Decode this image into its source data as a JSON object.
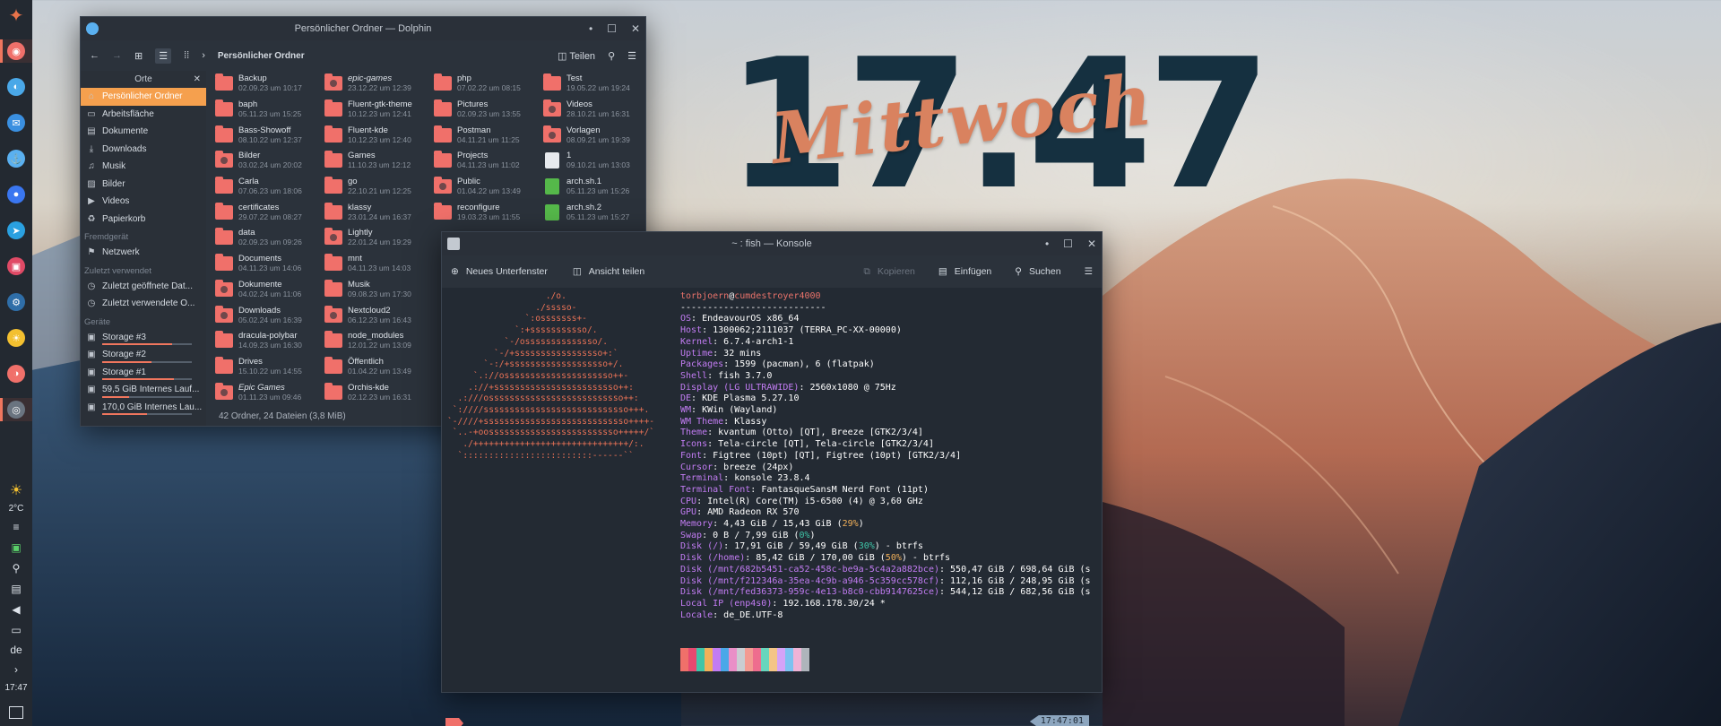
{
  "clock": {
    "time": "17.47",
    "day": "Mittwoch"
  },
  "panel": {
    "launcher_icon": "endeavour-logo-icon",
    "tasks": [
      {
        "name": "vivaldi",
        "color": "#f0706a",
        "glyph": "◉",
        "active": true
      },
      {
        "name": "firefox",
        "color": "#4aa8e8",
        "glyph": "◐",
        "active": false
      },
      {
        "name": "thunderbird",
        "color": "#3a8fe0",
        "glyph": "✉",
        "active": false
      },
      {
        "name": "mastodon",
        "color": "#5ab0f0",
        "glyph": "⚓",
        "active": false
      },
      {
        "name": "signal",
        "color": "#3a76f0",
        "glyph": "●",
        "active": false
      },
      {
        "name": "telegram",
        "color": "#2aa0e0",
        "glyph": "➤",
        "active": false
      },
      {
        "name": "store",
        "color": "#e04a66",
        "glyph": "▣",
        "active": false
      },
      {
        "name": "steam",
        "color": "#2f6ea8",
        "glyph": "⚙",
        "active": false
      },
      {
        "name": "sunny",
        "color": "#f3c030",
        "glyph": "☀",
        "active": false
      },
      {
        "name": "toggle",
        "color": "#f0706a",
        "glyph": "◑",
        "active": false
      },
      {
        "name": "disk",
        "color": "#6a7480",
        "glyph": "◎",
        "active": true
      }
    ],
    "weather_temp": "2°C",
    "keyboard_layout": "de",
    "time": "17:47"
  },
  "dolphin": {
    "title": "Persönlicher Ordner — Dolphin",
    "toolbar": {
      "breadcrumb": "Persönlicher Ordner",
      "split_label": "Teilen"
    },
    "places_header": "Orte",
    "places": [
      {
        "label": "Persönlicher Ordner",
        "icon": "⌂",
        "selected": true
      },
      {
        "label": "Arbeitsfläche",
        "icon": "▭"
      },
      {
        "label": "Dokumente",
        "icon": "▤"
      },
      {
        "label": "Downloads",
        "icon": "⤓"
      },
      {
        "label": "Musik",
        "icon": "♫"
      },
      {
        "label": "Bilder",
        "icon": "▨"
      },
      {
        "label": "Videos",
        "icon": "▶"
      },
      {
        "label": "Papierkorb",
        "icon": "♻"
      }
    ],
    "remote_header": "Fremdgerät",
    "remote": [
      {
        "label": "Netzwerk",
        "icon": "⚑"
      }
    ],
    "recent_header": "Zuletzt verwendet",
    "recent": [
      {
        "label": "Zuletzt geöffnete Dat...",
        "icon": "◷"
      },
      {
        "label": "Zuletzt verwendete O...",
        "icon": "◷"
      }
    ],
    "devices_header": "Geräte",
    "devices": [
      {
        "label": "Storage #3",
        "fill": 0.78
      },
      {
        "label": "Storage #2",
        "fill": 0.55
      },
      {
        "label": "Storage #1",
        "fill": 0.8
      },
      {
        "label": "59,5 GiB Internes Lauf...",
        "fill": 0.3
      },
      {
        "label": "170,0 GiB Internes Lau...",
        "fill": 0.5
      }
    ],
    "files": [
      {
        "name": "Backup",
        "date": "02.09.23 um 10:17",
        "kind": "folder"
      },
      {
        "name": "baph",
        "date": "05.11.23 um 15:25",
        "kind": "folder"
      },
      {
        "name": "Bass-Showoff",
        "date": "08.10.22 um 12:37",
        "kind": "folder"
      },
      {
        "name": "Bilder",
        "date": "03.02.24 um 20:02",
        "kind": "folder-img"
      },
      {
        "name": "Carla",
        "date": "07.06.23 um 18:06",
        "kind": "folder"
      },
      {
        "name": "certificates",
        "date": "29.07.22 um 08:27",
        "kind": "folder"
      },
      {
        "name": "data",
        "date": "02.09.23 um 09:26",
        "kind": "folder"
      },
      {
        "name": "Documents",
        "date": "04.11.23 um 14:06",
        "kind": "folder"
      },
      {
        "name": "Dokumente",
        "date": "04.02.24 um 11:06",
        "kind": "folder-img"
      },
      {
        "name": "Downloads",
        "date": "05.02.24 um 16:39",
        "kind": "folder-img"
      },
      {
        "name": "dracula-polybar",
        "date": "14.09.23 um 16:30",
        "kind": "folder"
      },
      {
        "name": "Drives",
        "date": "15.10.22 um 14:55",
        "kind": "folder"
      },
      {
        "name": "Epic Games",
        "date": "01.11.23 um 09:46",
        "kind": "folder-ic",
        "italic": true
      },
      {
        "name": "",
        "date": "",
        "kind": "empty"
      },
      {
        "name": "epic-games",
        "date": "23.12.22 um 12:39",
        "kind": "folder-ic",
        "italic": true
      },
      {
        "name": "Fluent-gtk-theme",
        "date": "10.12.23 um 12:41",
        "kind": "folder"
      },
      {
        "name": "Fluent-kde",
        "date": "10.12.23 um 12:40",
        "kind": "folder"
      },
      {
        "name": "Games",
        "date": "11.10.23 um 12:12",
        "kind": "folder"
      },
      {
        "name": "go",
        "date": "22.10.21 um 12:25",
        "kind": "folder"
      },
      {
        "name": "klassy",
        "date": "23.01.24 um 16:37",
        "kind": "folder"
      },
      {
        "name": "Lightly",
        "date": "22.01.24 um 19:29",
        "kind": "folder-img"
      },
      {
        "name": "mnt",
        "date": "04.11.23 um 14:03",
        "kind": "folder"
      },
      {
        "name": "Musik",
        "date": "09.08.23 um 17:30",
        "kind": "folder"
      },
      {
        "name": "Nextcloud2",
        "date": "06.12.23 um 16:43",
        "kind": "folder-ic"
      },
      {
        "name": "node_modules",
        "date": "12.01.22 um 13:09",
        "kind": "folder"
      },
      {
        "name": "Öffentlich",
        "date": "01.04.22 um 13:49",
        "kind": "folder"
      },
      {
        "name": "Orchis-kde",
        "date": "02.12.23 um 16:31",
        "kind": "folder"
      },
      {
        "name": "",
        "date": "",
        "kind": "empty"
      },
      {
        "name": "php",
        "date": "07.02.22 um 08:15",
        "kind": "folder"
      },
      {
        "name": "Pictures",
        "date": "02.09.23 um 13:55",
        "kind": "folder"
      },
      {
        "name": "Postman",
        "date": "04.11.21 um 11:25",
        "kind": "folder"
      },
      {
        "name": "Projects",
        "date": "04.11.23 um 11:02",
        "kind": "folder"
      },
      {
        "name": "Public",
        "date": "01.04.22 um 13:49",
        "kind": "folder-ic"
      },
      {
        "name": "reconfigure",
        "date": "19.03.23 um 11:55",
        "kind": "folder"
      },
      {
        "name": "",
        "date": "",
        "kind": "empty"
      },
      {
        "name": "",
        "date": "",
        "kind": "empty"
      },
      {
        "name": "",
        "date": "",
        "kind": "empty"
      },
      {
        "name": "",
        "date": "",
        "kind": "empty"
      },
      {
        "name": "",
        "date": "",
        "kind": "empty"
      },
      {
        "name": "",
        "date": "",
        "kind": "empty"
      },
      {
        "name": "",
        "date": "",
        "kind": "empty"
      },
      {
        "name": "",
        "date": "",
        "kind": "empty"
      },
      {
        "name": "Test",
        "date": "19.05.22 um 19:24",
        "kind": "folder"
      },
      {
        "name": "Videos",
        "date": "28.10.21 um 16:31",
        "kind": "folder-ic"
      },
      {
        "name": "Vorlagen",
        "date": "08.09.21 um 19:39",
        "kind": "folder-ic"
      },
      {
        "name": "1",
        "date": "09.10.21 um 13:03",
        "kind": "file"
      },
      {
        "name": "arch.sh.1",
        "date": "05.11.23 um 15:26",
        "kind": "script"
      },
      {
        "name": "arch.sh.2",
        "date": "05.11.23 um 15:27",
        "kind": "script"
      }
    ],
    "status": "42 Ordner, 24 Dateien (3,8 MiB)"
  },
  "konsole": {
    "title": "~ : fish — Konsole",
    "toolbar": {
      "new_tab": "Neues Unterfenster",
      "split": "Ansicht teilen",
      "copy": "Kopieren",
      "paste": "Einfügen",
      "find": "Suchen"
    },
    "logo_lines": [
      "                   ./o.",
      "                 ./sssso-",
      "               `:osssssss+-",
      "             `:+sssssssssso/.",
      "           `-/ossssssssssssso/.",
      "         `-/+sssssssssssssssso+:`",
      "       `-:/+sssssssssssssssssso+/.",
      "     `.://osssssssssssssssssssso++-",
      "    .://+ssssssssssssssssssssssso++:",
      "  .:///ossssssssssssssssssssssssso++:",
      " `:////ssssssssssssssssssssssssssso+++.",
      "`-////+ssssssssssssssssssssssssssso++++-",
      " `..-+oosssssssssssssssssssssssso+++++/`",
      "   ./++++++++++++++++++++++++++++++/:.",
      "  `:::::::::::::::::::::::::------``"
    ],
    "user": "torbjoern",
    "at": "@",
    "host": "cumdestroyer4000",
    "separator": "---------------------------",
    "info": [
      {
        "k": "OS",
        "v": "EndeavourOS x86_64"
      },
      {
        "k": "Host",
        "v": "1300062;2111037 (TERRA_PC-XX-00000)"
      },
      {
        "k": "Kernel",
        "v": "6.7.4-arch1-1"
      },
      {
        "k": "Uptime",
        "v": "32 mins"
      },
      {
        "k": "Packages",
        "v": "1599 (pacman), 6 (flatpak)"
      },
      {
        "k": "Shell",
        "v": "fish 3.7.0"
      },
      {
        "k": "Display (LG ULTRAWIDE)",
        "v": "2560x1080 @ 75Hz"
      },
      {
        "k": "DE",
        "v": "KDE Plasma 5.27.10"
      },
      {
        "k": "WM",
        "v": "KWin (Wayland)"
      },
      {
        "k": "WM Theme",
        "v": "Klassy"
      },
      {
        "k": "Theme",
        "v": "kvantum (Otto) [QT], Breeze [GTK2/3/4]"
      },
      {
        "k": "Icons",
        "v": "Tela-circle [QT], Tela-circle [GTK2/3/4]"
      },
      {
        "k": "Font",
        "v": "Figtree (10pt) [QT], Figtree (10pt) [GTK2/3/4]"
      },
      {
        "k": "Cursor",
        "v": "breeze (24px)"
      },
      {
        "k": "Terminal",
        "v": "konsole 23.8.4"
      },
      {
        "k": "Terminal Font",
        "v": "FantasqueSansM Nerd Font (11pt)"
      },
      {
        "k": "CPU",
        "v": "Intel(R) Core(TM) i5-6500 (4) @ 3,60 GHz"
      },
      {
        "k": "GPU",
        "v": "AMD Radeon RX 570"
      },
      {
        "k": "Memory",
        "v": "4,43 GiB / 15,43 GiB (",
        "pct": "29%",
        "end": ")",
        "pc": "y"
      },
      {
        "k": "Swap",
        "v": "0 B / 7,99 GiB (",
        "pct": "0%",
        "end": ")",
        "pc": "g"
      },
      {
        "k": "Disk (/)",
        "v": "17,91 GiB / 59,49 GiB (",
        "pct": "30%",
        "end": ") - btrfs",
        "pc": "g"
      },
      {
        "k": "Disk (/home)",
        "v": "85,42 GiB / 170,00 GiB (",
        "pct": "50%",
        "end": ") - btrfs",
        "pc": "y"
      },
      {
        "k": "Disk (/mnt/682b5451-ca52-458c-be9a-5c4a2a882bce)",
        "v": "550,47 GiB / 698,64 GiB (s"
      },
      {
        "k": "Disk (/mnt/f212346a-35ea-4c9b-a946-5c359cc578cf)",
        "v": "112,16 GiB / 248,95 GiB (s"
      },
      {
        "k": "Disk (/mnt/fed36373-959c-4e13-b8c0-cbb9147625ce)",
        "v": "544,12 GiB / 682,56 GiB (s"
      },
      {
        "k": "Local IP (enp4s0)",
        "v": "192.168.178.30/24 *"
      },
      {
        "k": "Locale",
        "v": "de_DE.UTF-8"
      }
    ],
    "palette": [
      "#f0706a",
      "#e64a70",
      "#3fc5a8",
      "#f1b05a",
      "#c27cf3",
      "#4aa8e8",
      "#e98fc7",
      "#c9cdd2",
      "#f39a92",
      "#ee6d8e",
      "#68d5bd",
      "#f4c586",
      "#d5a3f7",
      "#7cc2f0",
      "#efb3d6",
      "#aeb4bb"
    ],
    "right_prompt_time": "17:47:01",
    "prompt_char": "›"
  }
}
